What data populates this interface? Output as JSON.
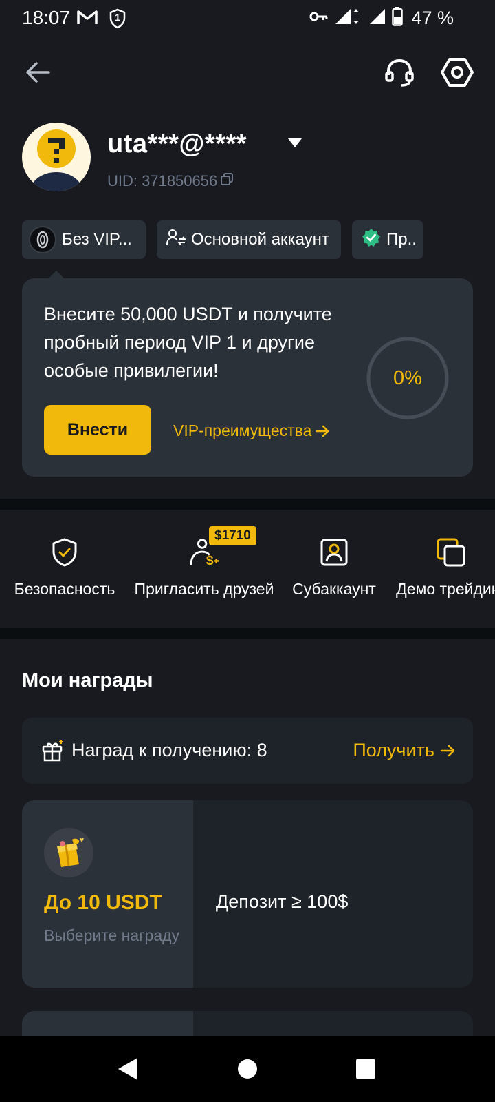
{
  "status_bar": {
    "time": "18:07",
    "notification_badge": "1",
    "battery": "47 %"
  },
  "header": {
    "back_icon": "arrow-left-icon",
    "support_icon": "headset-icon",
    "settings_icon": "hexagon-settings-icon"
  },
  "profile": {
    "username": "uta***@****",
    "uid": "UID: 371850656"
  },
  "chips": {
    "vip": "Без VIP...",
    "account": "Основной аккаунт",
    "verified": "Пр.."
  },
  "vip_card": {
    "text": "Внесите 50,000 USDT и получите пробный период VIP 1 и другие особые привилегии!",
    "deposit_button": "Внести",
    "link": "VIP-преимущества",
    "progress_label": "0%",
    "progress_fraction": 0
  },
  "quick_actions": {
    "security": "Безопасность",
    "invite": "Пригласить друзей",
    "invite_badge": "$1710",
    "subaccount": "Субаккаунт",
    "demo": "Демо трейдинг"
  },
  "rewards": {
    "title": "Мои награды",
    "claim_text": "Наград к получению: 8",
    "claim_link": "Получить",
    "card1": {
      "amount": "До 10 USDT",
      "subtitle": "Выберите награду",
      "condition": "Депозит ≥ 100$"
    }
  },
  "colors": {
    "accent": "#f0b90b",
    "background": "#181a20",
    "card": "#2b3139",
    "muted": "#707a8a"
  }
}
